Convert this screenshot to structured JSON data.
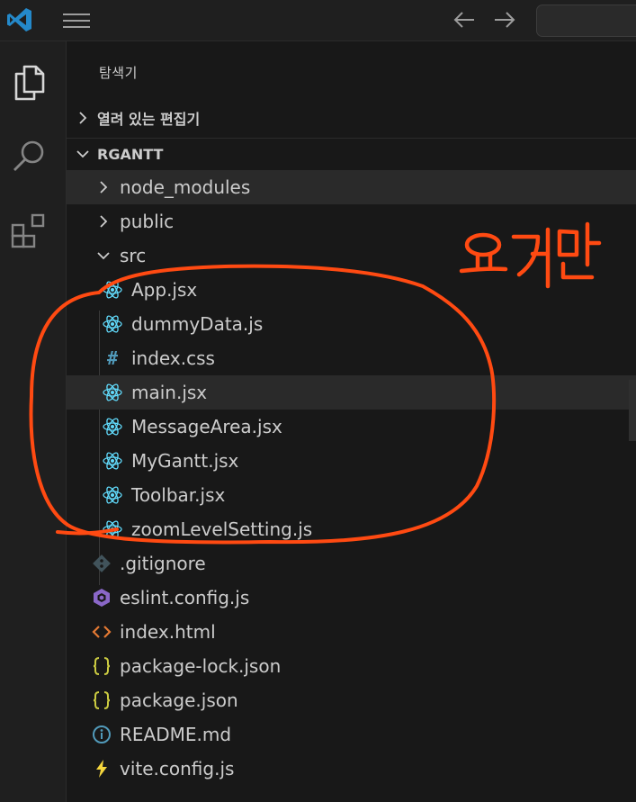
{
  "explorer": {
    "title": "탐색기",
    "open_editors_label": "열려 있는 편집기",
    "project_label": "RGANTT"
  },
  "tree": {
    "folders": [
      {
        "label": "node_modules",
        "expanded": false,
        "icon": "chevron-right-icon"
      },
      {
        "label": "public",
        "expanded": false,
        "icon": "chevron-right-icon"
      },
      {
        "label": "src",
        "expanded": true,
        "icon": "chevron-down-icon"
      }
    ],
    "src_files": [
      {
        "label": "App.jsx",
        "icon": "react-icon"
      },
      {
        "label": "dummyData.js",
        "icon": "react-icon"
      },
      {
        "label": "index.css",
        "icon": "css-hash-icon"
      },
      {
        "label": "main.jsx",
        "icon": "react-icon",
        "hovered": true
      },
      {
        "label": "MessageArea.jsx",
        "icon": "react-icon"
      },
      {
        "label": "MyGantt.jsx",
        "icon": "react-icon"
      },
      {
        "label": "Toolbar.jsx",
        "icon": "react-icon"
      },
      {
        "label": "zoomLevelSetting.js",
        "icon": "react-icon"
      }
    ],
    "root_files": [
      {
        "label": ".gitignore",
        "icon": "git-icon"
      },
      {
        "label": "eslint.config.js",
        "icon": "eslint-icon"
      },
      {
        "label": "index.html",
        "icon": "html-tag-icon"
      },
      {
        "label": "package-lock.json",
        "icon": "json-braces-icon"
      },
      {
        "label": "package.json",
        "icon": "json-braces-icon"
      },
      {
        "label": "README.md",
        "icon": "info-icon"
      },
      {
        "label": "vite.config.js",
        "icon": "vite-bolt-icon"
      }
    ]
  },
  "annotation": {
    "handwritten_text": "요거만",
    "color": "#ff4a12"
  },
  "colors": {
    "background": "#181818",
    "react": "#61dafb",
    "css": "#519aba",
    "json": "#cbcb41",
    "html": "#e37933",
    "eslint": "#8a67c8",
    "vscode_blue": "#2489ca"
  }
}
